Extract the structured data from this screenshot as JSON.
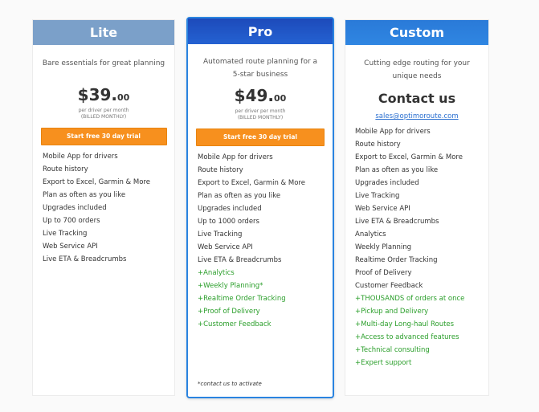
{
  "plans": {
    "lite": {
      "name": "Lite",
      "tagline": "Bare essentials for great planning",
      "price_main": "$39.",
      "price_cents": "00",
      "price_unit": "per driver per month",
      "billing": "(BILLED MONTHLY)",
      "cta_label": "Start free 30 day trial",
      "features": [
        "Mobile App for drivers",
        "Route history",
        "Export to Excel, Garmin & More",
        "Plan as often as you like",
        "Upgrades included",
        "Up to 700 orders",
        "Live Tracking",
        "Web Service API",
        "Live ETA & Breadcrumbs"
      ]
    },
    "pro": {
      "name": "Pro",
      "tagline_line1": "Automated route planning for a",
      "tagline_line2": "5-star business",
      "price_main": "$49.",
      "price_cents": "00",
      "price_unit": "per driver per month",
      "billing": "(BILLED MONTHLY)",
      "cta_label": "Start free 30 day trial",
      "features": [
        "Mobile App for drivers",
        "Route history",
        "Export to Excel, Garmin & More",
        "Plan as often as you like",
        "Upgrades included",
        "Up to 1000 orders",
        "Live Tracking",
        "Web Service API",
        "Live ETA & Breadcrumbs"
      ],
      "extras": [
        "+Analytics",
        "+Weekly Planning*",
        "+Realtime Order Tracking",
        "+Proof of Delivery",
        "+Customer Feedback"
      ],
      "footnote": "*contact us to activate"
    },
    "custom": {
      "name": "Custom",
      "tagline_line1": "Cutting edge routing for your",
      "tagline_line2": "unique needs",
      "contact_label": "Contact us",
      "email": "sales@optimoroute.com",
      "features": [
        "Mobile App for drivers",
        "Route history",
        "Export to Excel, Garmin & More",
        "Plan as often as you like",
        "Upgrades included",
        "Live Tracking",
        "Web Service API",
        "Live ETA & Breadcrumbs",
        "Analytics",
        "Weekly Planning",
        "Realtime Order Tracking",
        "Proof of Delivery",
        "Customer Feedback"
      ],
      "extras": [
        "+THOUSANDS of orders at once",
        "+Pickup and Delivery",
        "+Multi-day Long-haul Routes",
        "+Access to advanced features",
        "+Technical consulting",
        "+Expert support"
      ]
    }
  }
}
